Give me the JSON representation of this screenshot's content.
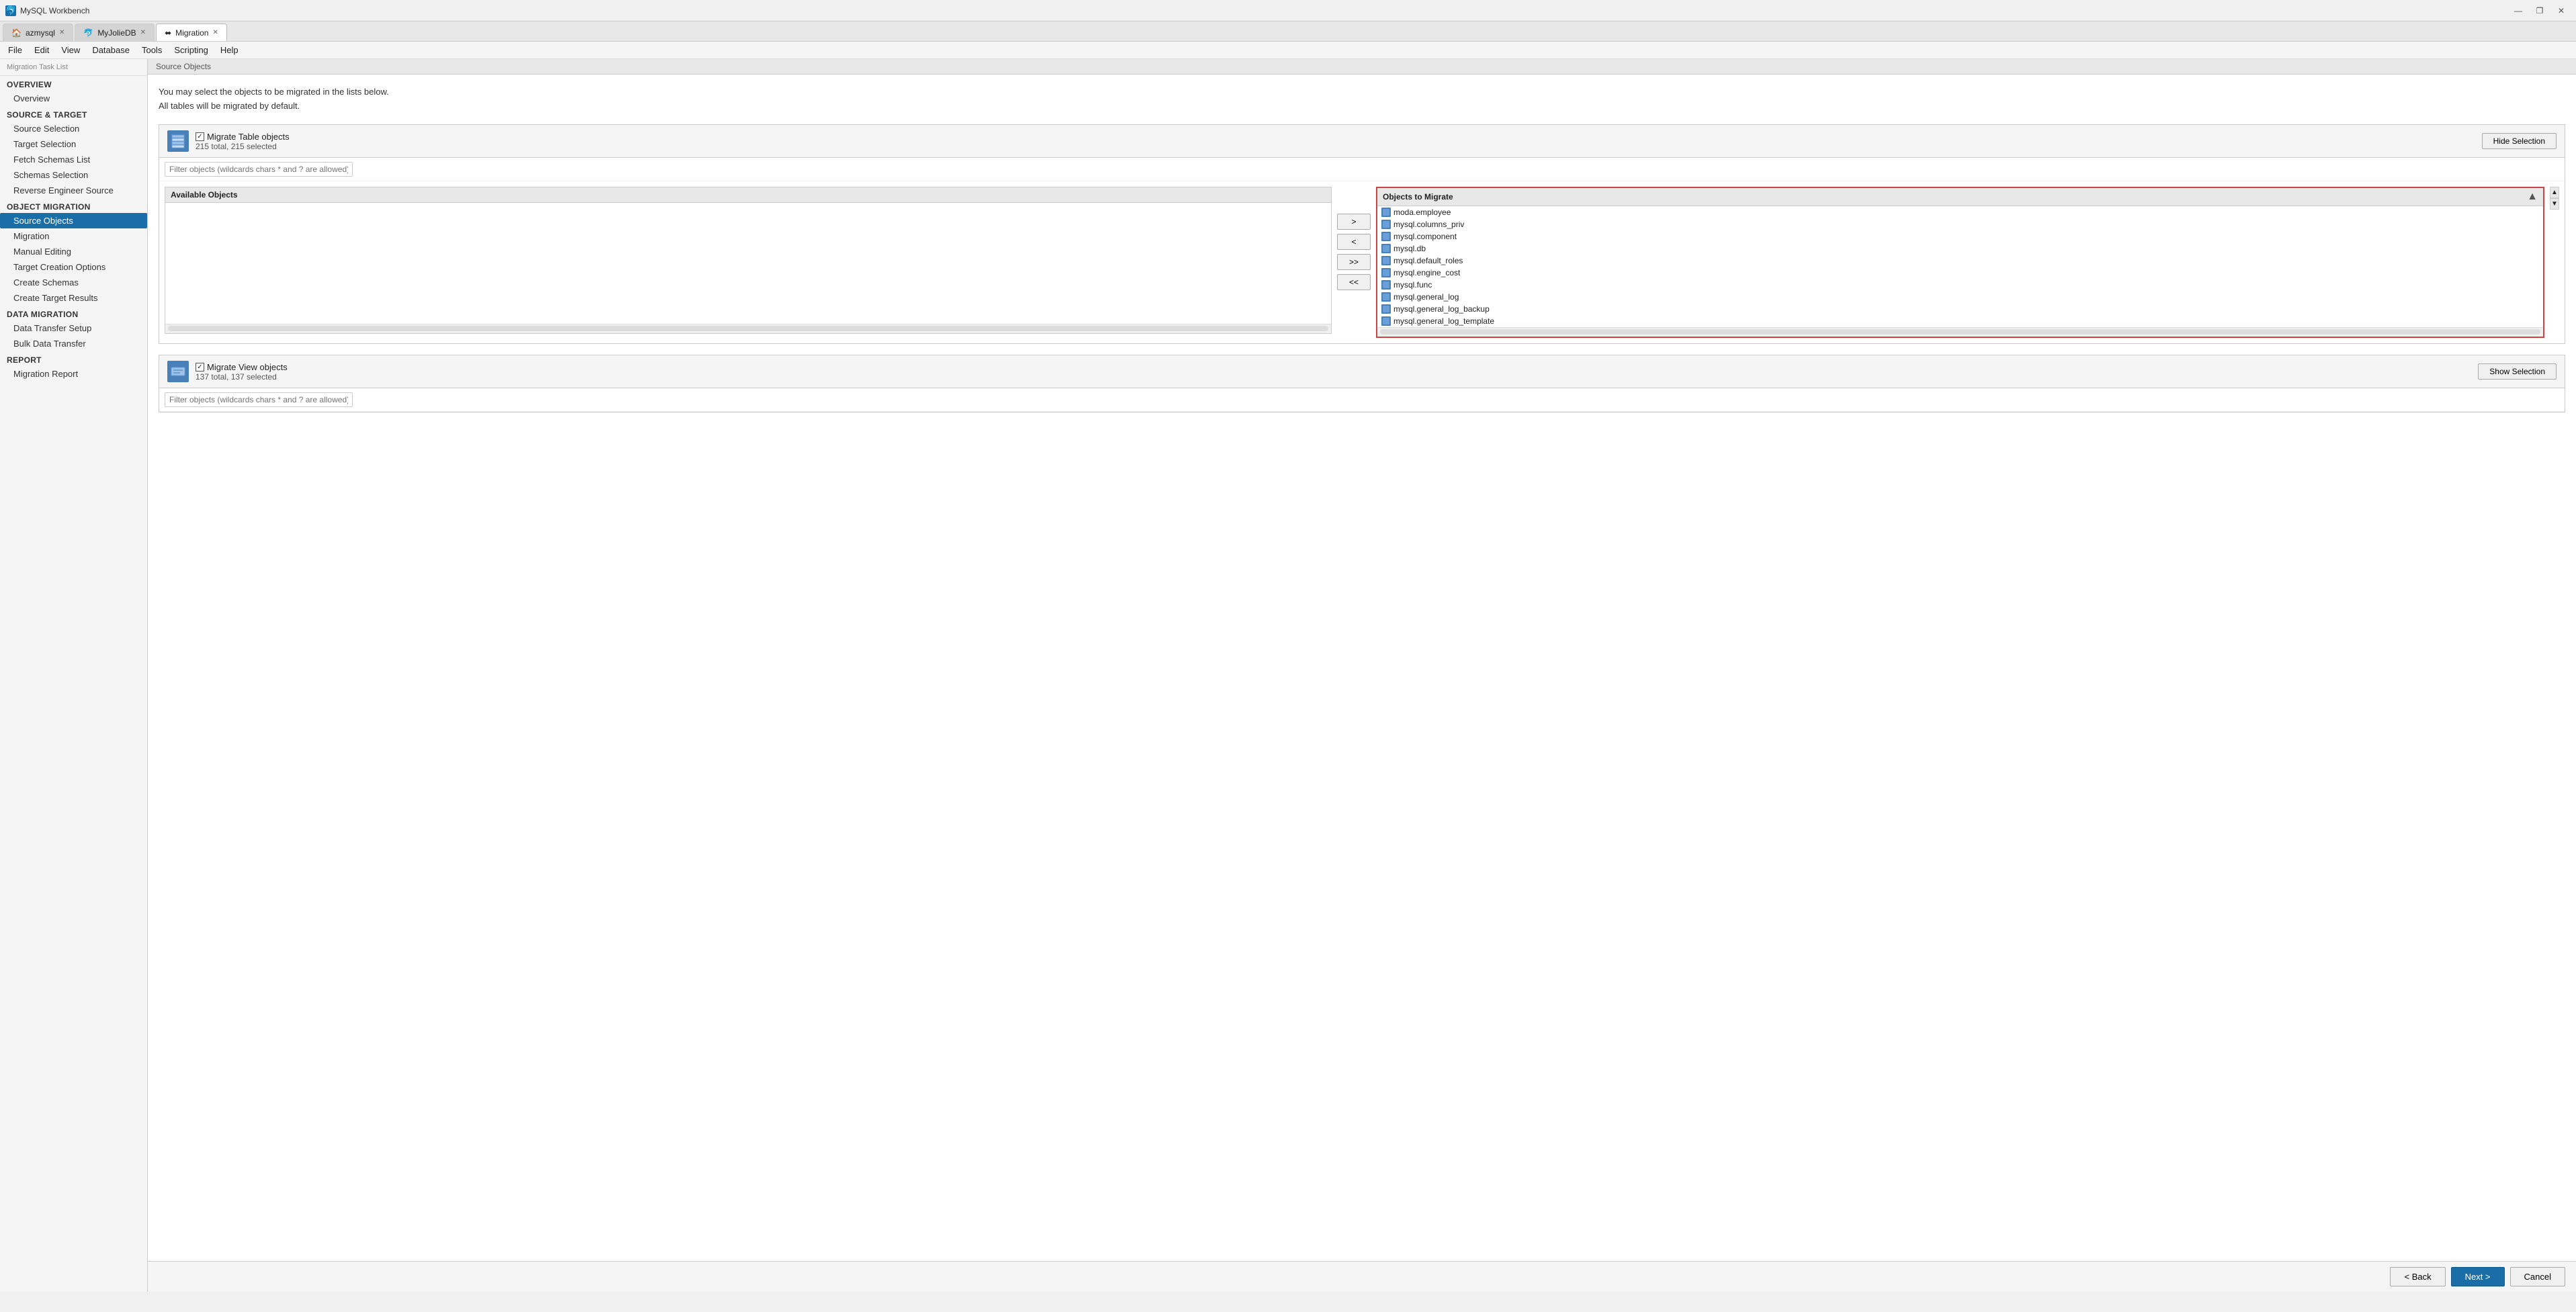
{
  "app": {
    "title": "MySQL Workbench",
    "icon": "🐬"
  },
  "tabs": [
    {
      "id": "azmysql",
      "label": "azmysql",
      "active": false,
      "closable": true
    },
    {
      "id": "myjolie",
      "label": "MyJolieDB",
      "active": false,
      "closable": true
    },
    {
      "id": "migration",
      "label": "Migration",
      "active": true,
      "closable": true
    }
  ],
  "menu": {
    "items": [
      "File",
      "Edit",
      "View",
      "Database",
      "Tools",
      "Scripting",
      "Help"
    ]
  },
  "sidebar": {
    "header_label": "Migration Task List",
    "sections": [
      {
        "category": "OVERVIEW",
        "items": [
          {
            "id": "overview",
            "label": "Overview",
            "active": false
          }
        ]
      },
      {
        "category": "SOURCE & TARGET",
        "items": [
          {
            "id": "source-selection",
            "label": "Source Selection",
            "active": false
          },
          {
            "id": "target-selection",
            "label": "Target Selection",
            "active": false
          },
          {
            "id": "fetch-schemas",
            "label": "Fetch Schemas List",
            "active": false
          },
          {
            "id": "schemas-selection",
            "label": "Schemas Selection",
            "active": false
          },
          {
            "id": "reverse-engineer",
            "label": "Reverse Engineer Source",
            "active": false
          }
        ]
      },
      {
        "category": "OBJECT MIGRATION",
        "items": [
          {
            "id": "source-objects",
            "label": "Source Objects",
            "active": true
          },
          {
            "id": "migration",
            "label": "Migration",
            "active": false
          },
          {
            "id": "manual-editing",
            "label": "Manual Editing",
            "active": false
          },
          {
            "id": "target-creation",
            "label": "Target Creation Options",
            "active": false
          },
          {
            "id": "create-schemas",
            "label": "Create Schemas",
            "active": false
          },
          {
            "id": "create-target",
            "label": "Create Target Results",
            "active": false
          }
        ]
      },
      {
        "category": "DATA MIGRATION",
        "items": [
          {
            "id": "data-transfer",
            "label": "Data Transfer Setup",
            "active": false
          },
          {
            "id": "bulk-transfer",
            "label": "Bulk Data Transfer",
            "active": false
          }
        ]
      },
      {
        "category": "REPORT",
        "items": [
          {
            "id": "migration-report",
            "label": "Migration Report",
            "active": false
          }
        ]
      }
    ]
  },
  "content": {
    "panel_header": "Source Objects",
    "intro_line1": "You may select the objects to be migrated in the lists below.",
    "intro_line2": "All tables will be migrated by default.",
    "table_objects": {
      "checkbox_label": "Migrate Table objects",
      "count": "215 total, 215 selected",
      "filter_placeholder": "Filter objects (wildcards chars * and ? are allowed)",
      "available_header": "Available Objects",
      "migrate_header": "Objects to Migrate",
      "hide_btn": "Hide Selection",
      "transfer_btns": [
        ">",
        "<",
        ">>",
        "<<"
      ],
      "migrate_items": [
        "moda.employee",
        "mysql.columns_priv",
        "mysql.component",
        "mysql.db",
        "mysql.default_roles",
        "mysql.engine_cost",
        "mysql.func",
        "mysql.general_log",
        "mysql.general_log_backup",
        "mysql.general_log_template"
      ]
    },
    "view_objects": {
      "checkbox_label": "Migrate View objects",
      "count": "137 total, 137 selected",
      "filter_placeholder": "Filter objects (wildcards chars * and ? are allowed)",
      "show_btn": "Show Selection"
    }
  },
  "footer": {
    "back_label": "< Back",
    "next_label": "Next >",
    "cancel_label": "Cancel"
  },
  "titlebar_controls": [
    "—",
    "❐",
    "✕"
  ]
}
